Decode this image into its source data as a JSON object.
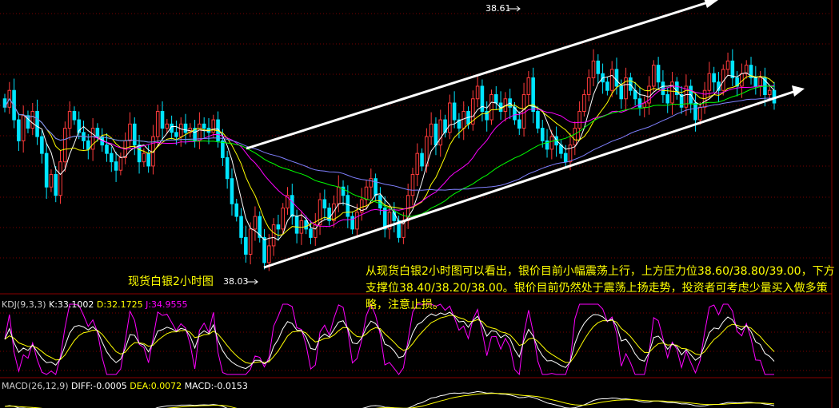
{
  "chart_data": {
    "type": "candlestick",
    "title": "现货白银2小时图",
    "annotation": "从现货白银2小时图可以看出，银价目前小幅震荡上行，上方压力位38.60/38.80/39.00，下方支撑位38.40/38.20/38.00。银价目前仍然处于震荡上扬走势，投资者可考虑少量买入做多策略，注意止损。",
    "high_marker": "38.61",
    "low_marker": "38.03",
    "high_value": 38.61,
    "low_value": 38.03,
    "ohlc_close": [
      38.41,
      38.45,
      38.38,
      38.33,
      38.39,
      38.36,
      38.4,
      38.34,
      38.3,
      38.22,
      38.25,
      38.2,
      38.28,
      38.36,
      38.4,
      38.38,
      38.35,
      38.33,
      38.31,
      38.36,
      38.34,
      38.32,
      38.3,
      38.28,
      38.26,
      38.29,
      38.33,
      38.37,
      38.32,
      38.28,
      38.3,
      38.27,
      38.34,
      38.4,
      38.36,
      38.37,
      38.35,
      38.34,
      38.37,
      38.35,
      38.36,
      38.33,
      38.37,
      38.36,
      38.35,
      38.38,
      38.33,
      38.29,
      38.24,
      38.18,
      38.15,
      38.1,
      38.06,
      38.12,
      38.15,
      38.1,
      38.04,
      38.08,
      38.13,
      38.12,
      38.17,
      38.2,
      38.15,
      38.11,
      38.14,
      38.12,
      38.1,
      38.13,
      38.19,
      38.17,
      38.14,
      38.18,
      38.22,
      38.2,
      38.15,
      38.12,
      38.16,
      38.19,
      38.22,
      38.24,
      38.2,
      38.17,
      38.12,
      38.16,
      38.14,
      38.1,
      38.14,
      38.2,
      38.25,
      38.3,
      38.27,
      38.34,
      38.37,
      38.32,
      38.38,
      38.35,
      38.42,
      38.38,
      38.36,
      38.4,
      38.37,
      38.43,
      38.46,
      38.4,
      38.38,
      38.44,
      38.42,
      38.4,
      38.43,
      38.41,
      38.38,
      38.36,
      38.44,
      38.48,
      38.4,
      38.36,
      38.33,
      38.31,
      38.34,
      38.32,
      38.3,
      38.28,
      38.32,
      38.36,
      38.4,
      38.44,
      38.48,
      38.52,
      38.49,
      38.47,
      38.45,
      38.5,
      38.46,
      38.43,
      38.48,
      38.45,
      38.43,
      38.41,
      38.42,
      38.46,
      38.51,
      38.47,
      38.44,
      38.42,
      38.47,
      38.44,
      38.41,
      38.46,
      38.42,
      38.38,
      38.41,
      38.45,
      38.49,
      38.47,
      38.45,
      38.5,
      38.52,
      38.48,
      38.46,
      38.49,
      38.51,
      38.48,
      38.46,
      38.48,
      38.44,
      38.45,
      38.42
    ],
    "ylim": [
      38.0,
      38.65
    ],
    "indicators": [
      {
        "label": "KDJ(9,3,3)",
        "values": [
          {
            "text": "K:33.1002",
            "color": "#ffffff"
          },
          {
            "text": "D:32.1725",
            "color": "#ffff00"
          },
          {
            "text": "J:34.9555",
            "color": "#ff00ff"
          }
        ]
      },
      {
        "label": "MACD(26,12,9)",
        "values": [
          {
            "text": "DIFF:-0.0005",
            "color": "#ffffff"
          },
          {
            "text": "DEA:0.0072",
            "color": "#ffff00"
          },
          {
            "text": "MACD:-0.0153",
            "color": "#ffffff"
          }
        ]
      }
    ]
  },
  "colors": {
    "up": "#ff3b3b",
    "down": "#00e5ff",
    "ma_white": "#ffffff",
    "ma_yellow": "#ffff00",
    "ma_magenta": "#ff00ff",
    "ma_green": "#00ff00",
    "ma_blue": "#8080ff",
    "grid": "#7a0000",
    "trendline": "#ffffff"
  }
}
